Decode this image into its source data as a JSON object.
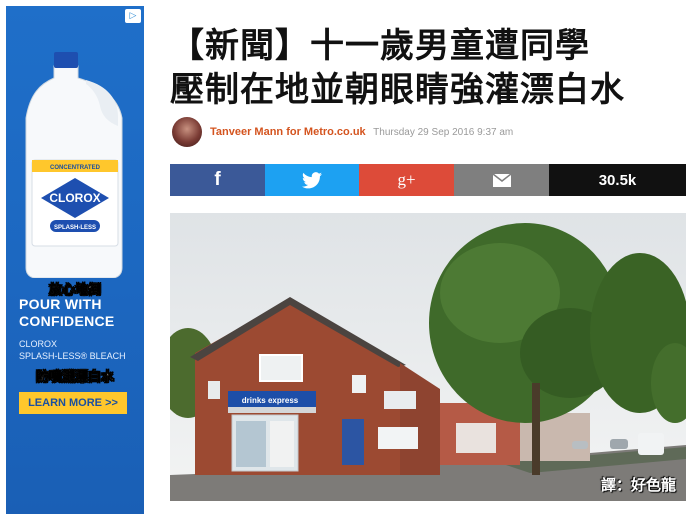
{
  "ad": {
    "caption_top": "放心地倒",
    "headline": "POUR WITH CONFIDENCE",
    "product_line1": "CLOROX",
    "product_line2": "SPLASH-LESS® BLEACH",
    "caption_bottom": "防噴濺漂白水",
    "cta": "LEARN MORE >>",
    "label_brand": "CLOROX",
    "label_concentrated": "CONCENTRATED",
    "label_sub": "SPLASH-LESS"
  },
  "article": {
    "headline_line1": "【新聞】十一歲男童遭同學",
    "headline_line2": "壓制在地並朝眼睛強灌漂白水",
    "author": "Tanveer Mann for Metro.co.uk",
    "date": "Thursday 29 Sep 2016 9:37 am"
  },
  "share": {
    "facebook_icon": "f",
    "twitter_icon": "twitter-bird",
    "gplus_icon": "g+",
    "email_icon": "envelope",
    "count": "30.5k"
  },
  "photo": {
    "shop_sign": "drinks express",
    "credit": "譯：好色龍"
  },
  "colors": {
    "author": "#d4541f",
    "facebook": "#3b5998",
    "twitter": "#1da1f2",
    "gplus": "#dd4b39",
    "email": "#7f7f7f",
    "count_bg": "#111111",
    "ad_bg": "#1f6fc9",
    "cta_bg": "#ffc72c"
  }
}
